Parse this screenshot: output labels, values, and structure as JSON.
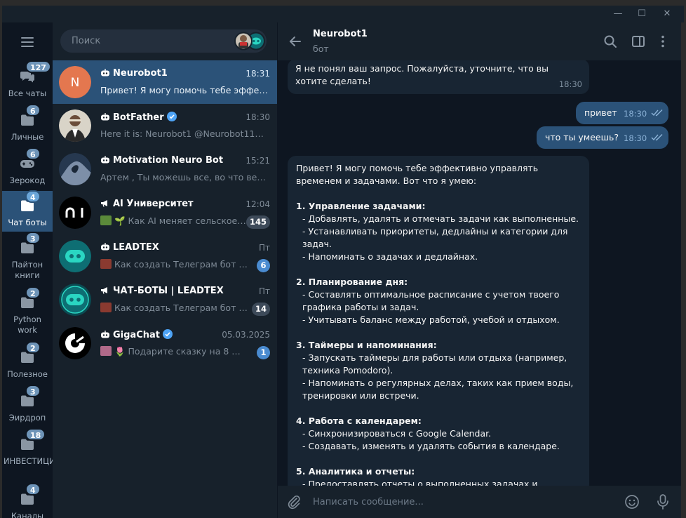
{
  "window": {
    "minimize": "—",
    "maximize": "☐",
    "close": "✕"
  },
  "folders": [
    {
      "label": "Все чаты",
      "badge": "127",
      "icon": "chat-bubbles-icon"
    },
    {
      "label": "Личные",
      "badge": "6",
      "icon": "folder-icon"
    },
    {
      "label": "Зерокод",
      "badge": "6",
      "icon": "gamepad-icon"
    },
    {
      "label": "Чат боты",
      "badge": "4",
      "icon": "folder-icon",
      "active": true
    },
    {
      "label": "Пайтон книги",
      "badge": "3",
      "icon": "folder-icon"
    },
    {
      "label": "Python work",
      "badge": "2",
      "icon": "folder-icon"
    },
    {
      "label": "Полезное",
      "badge": "2",
      "icon": "folder-icon"
    },
    {
      "label": "Эирдроп",
      "badge": "3",
      "icon": "folder-icon"
    },
    {
      "label": "ИНВЕСТИЦИИ",
      "badge": "18",
      "icon": "folder-icon"
    },
    {
      "label": "Каналы",
      "badge": "4",
      "icon": "folder-icon"
    }
  ],
  "search": {
    "placeholder": "Поиск"
  },
  "chats": [
    {
      "name": "Neurobot1",
      "time": "18:31",
      "preview": "Привет! Я могу помочь тебе эффективно управлять",
      "avatar_letter": "N",
      "bot": true,
      "active": true
    },
    {
      "name": "BotFather",
      "time": "18:30",
      "preview": "Here it is: Neurobot1 @Neurobot111_bot",
      "bot": true,
      "verified": true
    },
    {
      "name": "Motivation Neuro Bot",
      "time": "15:21",
      "preview": "Артем , Ты можешь все, во что веришь",
      "bot": true
    },
    {
      "name": "AI Университет",
      "time": "12:04",
      "preview": "🌱 Как AI меняет сельское хозяйство",
      "unread": "145",
      "channel": true
    },
    {
      "name": "LEADTEX",
      "time": "Пт",
      "preview": "Как создать Телеграм бот для бизнеса",
      "unread": "6",
      "unread_blue": true,
      "bot": true
    },
    {
      "name": "ЧАТ-БОТЫ | LEADTEX",
      "time": "Пт",
      "preview": "Как создать Телеграм бот для бизнеса",
      "unread": "14",
      "channel": true
    },
    {
      "name": "GigaChat",
      "time": "05.03.2025",
      "preview": "🌷 Подарите сказку на 8 Марта",
      "unread": "1",
      "unread_blue": true,
      "bot": true,
      "verified": true
    }
  ],
  "conversation": {
    "title": "Neurobot1",
    "subtitle": "бот",
    "messages": [
      {
        "dir": "in",
        "text": "Я не понял ваш запрос. Пожалуйста, уточните, что вы хотите сделать!",
        "time": "18:30"
      },
      {
        "dir": "out",
        "text": "привет",
        "time": "18:30"
      },
      {
        "dir": "out",
        "text": "что ты умеешь?",
        "time": "18:30"
      }
    ],
    "long_message": {
      "intro": "Привет! Я могу помочь тебе эффективно управлять временем и задачами. Вот что я умею:",
      "sections": [
        {
          "heading": "1. Управление задачами:",
          "items": [
            "- Добавлять, удалять и отмечать задачи как выполненные.",
            "- Устанавливать приоритеты, дедлайны и категории для задач.",
            "- Напоминать о задачах и дедлайнах."
          ]
        },
        {
          "heading": "2. Планирование дня:",
          "items": [
            "- Составлять оптимальное расписание с учетом твоего графика работы и задач.",
            "- Учитывать баланс между работой, учебой и отдыхом."
          ]
        },
        {
          "heading": "3. Таймеры и напоминания:",
          "items": [
            "- Запускать таймеры для работы или отдыха (например, техника Pomodoro).",
            "- Напоминать о регулярных делах, таких как прием воды, тренировки или встречи."
          ]
        },
        {
          "heading": "4. Работа с календарем:",
          "items": [
            "- Синхронизироваться с Google Calendar.",
            "- Создавать, изменять и удалять события в календаре."
          ]
        },
        {
          "heading": "5. Аналитика и отчеты:",
          "items": [
            "- Предоставлять отчеты о выполненных задачах и затраченном времени."
          ]
        }
      ]
    },
    "composer_placeholder": "Написать сообщение..."
  },
  "colors": {
    "accent": "#2b5278",
    "panel": "#17212b",
    "background": "#0e1621",
    "badge_blue": "#4a8bd0"
  }
}
